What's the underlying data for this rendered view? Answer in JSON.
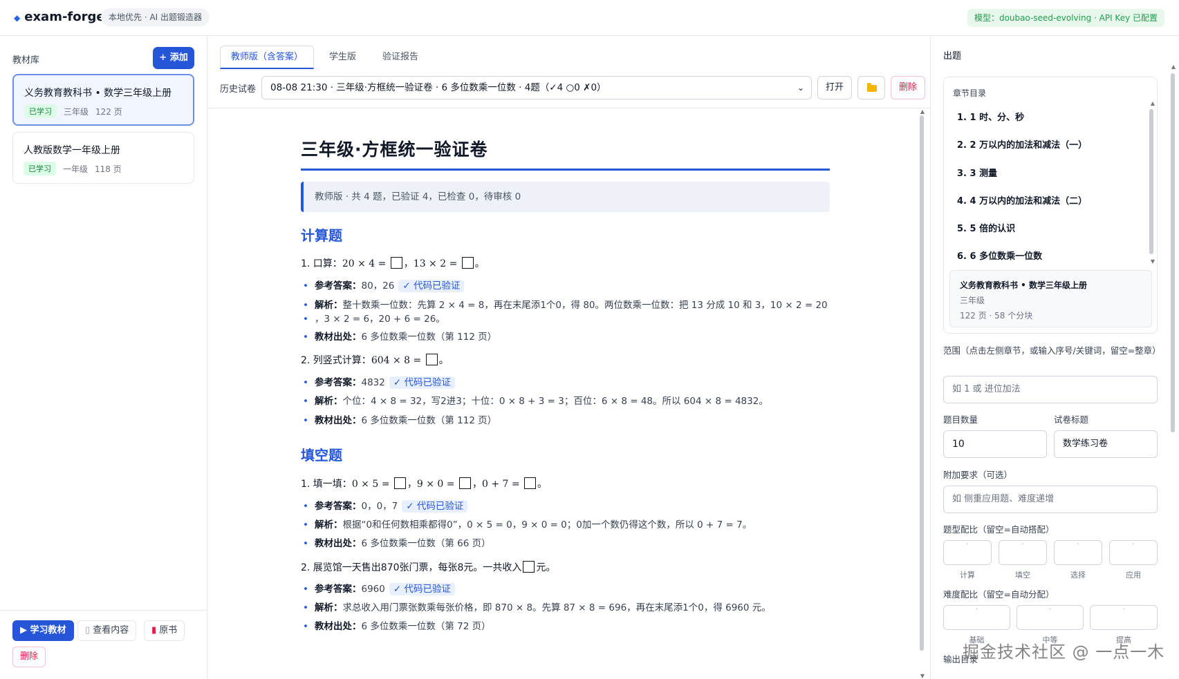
{
  "app": {
    "name": "exam-forge",
    "tagline": "本地优先 · AI 出题锻造器",
    "model_badge": "模型：doubao-seed-evolving · API Key 已配置"
  },
  "library": {
    "title": "教材库",
    "add_label": "+ 添加",
    "books": [
      {
        "title": "义务教育教科书 • 数学三年级上册",
        "status": "已学习",
        "grade": "三年级",
        "pages": "122 页"
      },
      {
        "title": "人教版数学一年级上册",
        "status": "已学习",
        "grade": "一年级",
        "pages": "118 页"
      }
    ],
    "actions": {
      "learn": "▶ 学习教材",
      "view": "查看内容",
      "original": "原书",
      "delete": "删除"
    }
  },
  "center": {
    "tabs": [
      "教师版（含答案）",
      "学生版",
      "验证报告"
    ],
    "history_label": "历史试卷",
    "history_value": "08-08 21:30 · 三年级·方框统一验证卷 · 6 多位数乘一位数 · 4题（✓4 ○0 ✗0）",
    "open_label": "打开",
    "delete_label": "删除"
  },
  "doc": {
    "title": "三年级·方框统一验证卷",
    "note": "教师版 · 共 4 题，已验证 4，已检查 0，待审核 0",
    "labels": {
      "answer": "参考答案：",
      "analysis": "解析：",
      "source": "教材出处：",
      "verified": "✓ 代码已验证"
    },
    "sections": [
      {
        "name": "计算题",
        "questions": [
          {
            "q_pre": "1. 口算：",
            "q_math": [
              "20 × 4 = ",
              "，13 × 2 = ",
              "。"
            ],
            "answer": "80，26",
            "analysis": "整十数乘一位数：先算 2 × 4 = 8，再在末尾添1个0，得 80。两位数乘一位数：把 13 分成 10 和 3，10 × 2 = 20",
            "analysis2": "，3 × 2 = 6，20 + 6 = 26。",
            "source": "6 多位数乘一位数（第 112 页）"
          },
          {
            "q_pre": "2. 列竖式计算：",
            "q_math": [
              "604 × 8 = ",
              "。"
            ],
            "answer": "4832",
            "analysis": "个位：4 × 8 = 32，写2进3；十位：0 × 8 + 3 = 3；百位：6 × 8 = 48。所以 604 × 8 = 4832。",
            "source": "6 多位数乘一位数（第 112 页）"
          }
        ]
      },
      {
        "name": "填空题",
        "questions": [
          {
            "q_pre": "1. 填一填：",
            "q_math": [
              "0 × 5 = ",
              "，9 × 0 = ",
              "，0 + 7 = ",
              "。"
            ],
            "answer": "0，0，7",
            "analysis": "根据“0和任何数相乘都得0”，0 × 5 = 0，9 × 0 = 0；0加一个数仍得这个数，所以 0 + 7 = 7。",
            "source": "6 多位数乘一位数（第 66 页）"
          },
          {
            "q_pre": "2. 展览馆一天售出870张门票，每张8元。一共收入",
            "q_math": [
              "",
              "元。"
            ],
            "answer": "6960",
            "analysis": "求总收入用门票张数乘每张价格，即 870 × 8。先算 87 × 8 = 696，再在末尾添1个0，得 6960 元。",
            "source": "6 多位数乘一位数（第 72 页）"
          }
        ]
      }
    ]
  },
  "generator": {
    "title": "出题",
    "toc_title": "章节目录",
    "chapters": [
      "1. 1 时、分、秒",
      "2. 2 万以内的加法和减法（一）",
      "3. 3 测量",
      "4. 4 万以内的加法和减法（二）",
      "5. 5 倍的认识",
      "6. 6 多位数乘一位数"
    ],
    "toc_book": {
      "title": "义务教育教科书 • 数学三年级上册",
      "grade": "三年级",
      "meta": "122 页 · 58 个分块"
    },
    "range_label": "范围（点击左侧章节，或输入序号/关键词，留空=整章）",
    "range_placeholder": "如 1 或 进位加法",
    "count_label": "题目数量",
    "count_value": "10",
    "paper_title_label": "试卷标题",
    "paper_title_value": "数学练习卷",
    "extra_label": "附加要求（可选）",
    "extra_placeholder": "如 侧重应用题、难度递增",
    "type_mix_label": "题型配比（留空=自动搭配）",
    "types": [
      "计算",
      "填空",
      "选择",
      "应用"
    ],
    "difficulty_label": "难度配比（留空=自动分配）",
    "difficulties": [
      "基础",
      "中等",
      "提高"
    ],
    "output_label": "输出目录",
    "watermark": "掘金技术社区 @ 一点一木"
  },
  "colors": {
    "accent": "#2556d8",
    "success": "#1e9e4e",
    "danger": "#e11d48"
  }
}
